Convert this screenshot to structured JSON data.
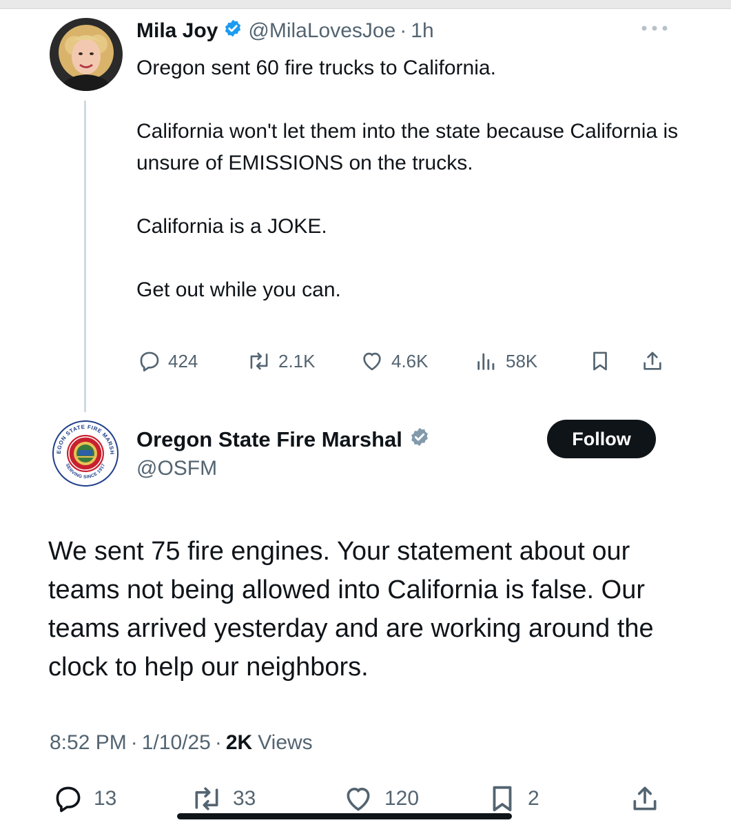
{
  "parent_tweet": {
    "name": "Mila Joy",
    "handle": "@MilaLovesJoe",
    "separator": "·",
    "time": "1h",
    "paragraphs": [
      "Oregon sent 60 fire trucks to California.",
      "California won't let them into the state because California is unsure of EMISSIONS on the trucks.",
      "California is a JOKE.",
      "Get out while you can."
    ],
    "replies": "424",
    "reposts": "2.1K",
    "likes": "4.6K",
    "views": "58K"
  },
  "reply_tweet": {
    "name": "Oregon State Fire Marshal",
    "handle": "@OSFM",
    "follow_label": "Follow",
    "text": "We sent 75 fire engines. Your statement about our teams not being allowed into California is false. Our teams arrived yesterday and are working around the clock to help our neighbors.",
    "time": "8:52 PM",
    "date": "1/10/25",
    "separator": "·",
    "views_count": "2K",
    "views_label": "Views",
    "replies": "13",
    "reposts": "33",
    "likes": "120",
    "bookmarks": "2"
  },
  "logo_text": {
    "top": "OREGON STATE FIRE MARSHAL",
    "bottom": "SERVING SINCE 1917"
  },
  "colors": {
    "verified_blue": "#1d9bf0",
    "verified_gray": "#829aab",
    "text": "#0f1419",
    "muted": "#536471",
    "thread_line": "#cfd9de",
    "follow_bg": "#0f1419"
  }
}
